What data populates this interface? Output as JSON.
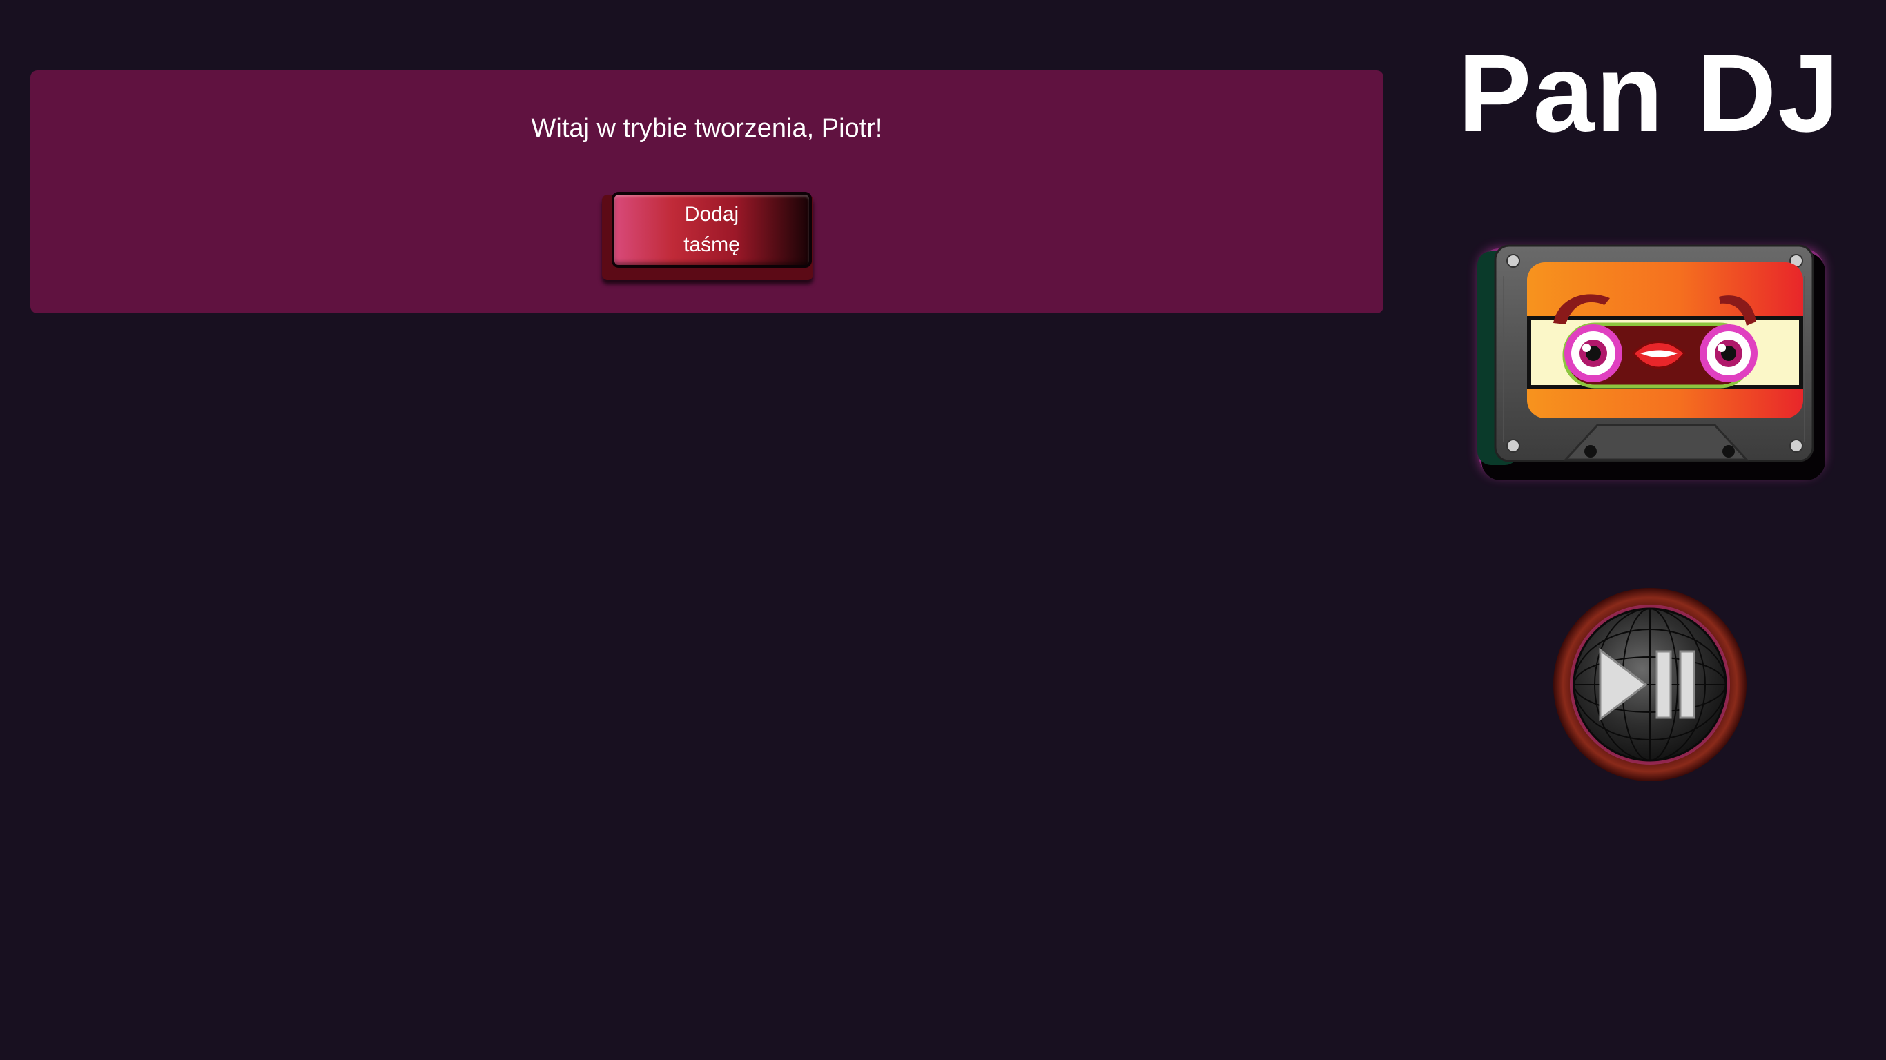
{
  "app": {
    "title": "Pan DJ"
  },
  "welcome_panel": {
    "message": "Witaj w trybie tworzenia, Piotr!",
    "add_tape_button_label": "Dodaj taśmę"
  },
  "icons": {
    "mascot": "cassette-mascot-icon",
    "player": "play-pause-icon"
  },
  "colors": {
    "background": "#181020",
    "panel": "#601240",
    "button_accent": "#c02a38",
    "cassette_label_orange": "#f7931e",
    "cassette_label_red": "#e8262a",
    "glow_pink": "#e040c0"
  }
}
